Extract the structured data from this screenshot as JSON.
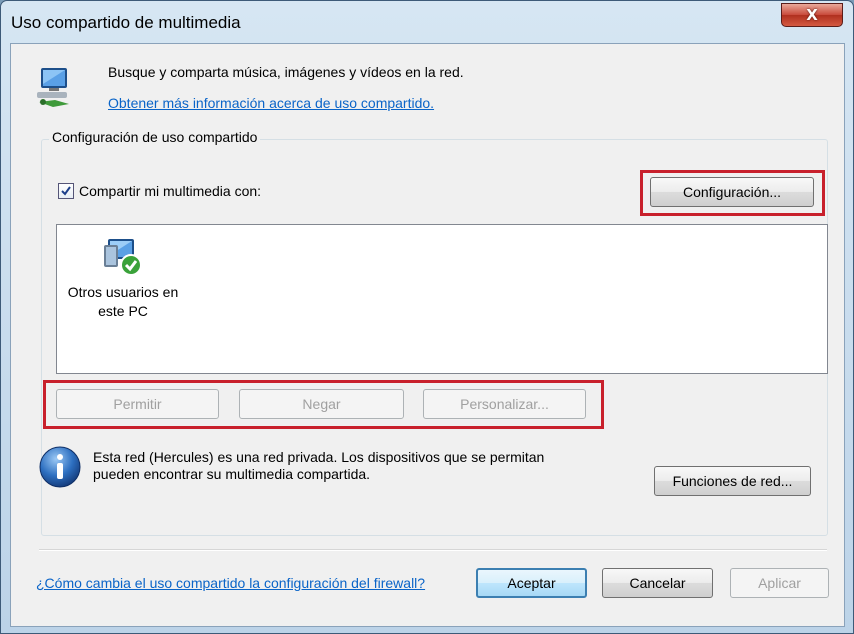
{
  "window": {
    "title": "Uso compartido de multimedia",
    "close_label": "X"
  },
  "header": {
    "description": "Busque y comparta música, imágenes y vídeos en la red.",
    "learn_more_link": "Obtener más información acerca de uso compartido."
  },
  "sharing_settings": {
    "group_label": "Configuración de uso compartido",
    "share_checkbox_label": "Compartir mi multimedia con:",
    "share_checked": true,
    "settings_button": "Configuración...",
    "devices": [
      {
        "line1": "Otros usuarios en",
        "line2": "este PC",
        "icon": "network-users-check-icon"
      }
    ],
    "allow_button": "Permitir",
    "deny_button": "Negar",
    "customize_button": "Personalizar..."
  },
  "network_info": {
    "line1": "Esta red (Hercules) es una red privada. Los dispositivos que se permitan",
    "line2": "pueden encontrar su multimedia compartida.",
    "network_functions_button": "Funciones de red..."
  },
  "footer": {
    "firewall_link": "¿Cómo cambia el uso compartido la configuración del firewall?",
    "ok_button": "Aceptar",
    "cancel_button": "Cancelar",
    "apply_button": "Aplicar"
  },
  "colors": {
    "highlight": "#c8202c",
    "link": "#0a64c8"
  }
}
